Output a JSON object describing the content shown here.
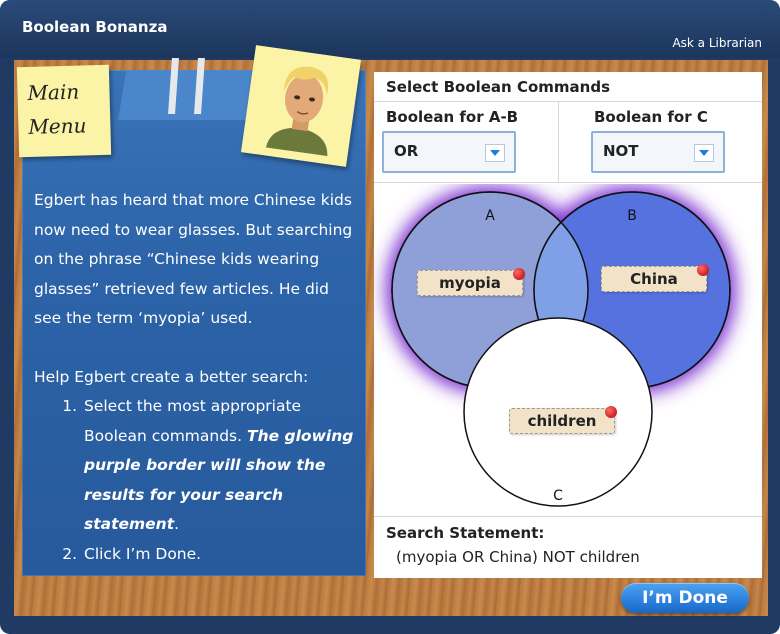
{
  "app": {
    "title": "Boolean Bonanza",
    "help_link": "Ask a Librarian"
  },
  "main_menu": {
    "line1": "Main",
    "line2": "Menu"
  },
  "scenario": {
    "paragraph": "Egbert has heard that more Chinese kids now need to wear glasses. But searching on the phrase “Chinese kids wearing glasses” retrieved few articles. He did see the term ‘myopia’ used.",
    "help_intro": "Help Egbert create a better search:",
    "step1_prefix": "Select the most appropriate Boolean commands. ",
    "step1_emphasis": "The glowing purple border will show the results for your search statement",
    "step1_suffix": ".",
    "step2": "Click I’m Done."
  },
  "commands": {
    "title": "Select Boolean Commands",
    "ab_label": "Boolean for A-B",
    "ab_value": "OR",
    "c_label": "Boolean for C",
    "c_value": "NOT"
  },
  "venn": {
    "circle_a": "A",
    "circle_b": "B",
    "circle_c": "C",
    "term_a": "myopia",
    "term_b": "China",
    "term_c": "children",
    "colors": {
      "a": "#8f9fd8",
      "b": "#5672df",
      "c": "#ffffff",
      "glow": "#7a2fd0"
    }
  },
  "search": {
    "label": "Search Statement:",
    "statement": "(myopia OR China) NOT children"
  },
  "done_button": "I’m Done"
}
